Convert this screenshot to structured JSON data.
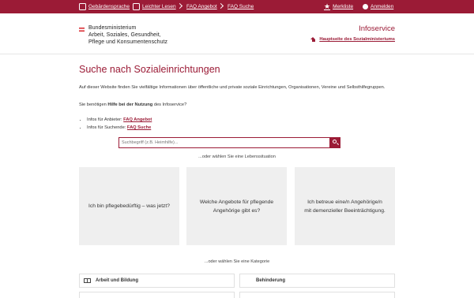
{
  "topbar": {
    "sign_language": "Gebärdensprache",
    "easy_reading": "Leichter Lesen",
    "faq_offer": "FAQ Angebot",
    "faq_search": "FAQ Suche",
    "watchlist": "Merkliste",
    "login": "Anmelden"
  },
  "header": {
    "ministry_line1": "Bundesministerium",
    "ministry_line2": "Arbeit, Soziales, Gesundheit,",
    "ministry_line3": "Pflege und Konsumentenschutz",
    "service_name": "Infoservice",
    "home_link": "Hauptseite des Sozialministeriums"
  },
  "main": {
    "title": "Suche nach Sozialeinrichtungen",
    "intro": "Auf dieser Website finden Sie vielfältige Informationen über öffentliche und private soziale Einrichtungen, Organisationen, Vereine und Selbsthilfegruppen.",
    "help_prefix": "Sie benötigen ",
    "help_bold": "Hilfe bei der Nutzung",
    "help_suffix": " des Infoservice?",
    "bullets": [
      {
        "prefix": "Infos für Anbieter: ",
        "link": "FAQ Angebot"
      },
      {
        "prefix": "Infos für Suchende: ",
        "link": "FAQ Suche"
      }
    ],
    "search_placeholder": "Suchbegriff (z.B. Heimhilfe)...",
    "situation_prompt": "...oder wählen Sie eine Lebenssituation",
    "situations": [
      "Ich bin pflegebedürftig – was jetzt?",
      "Welche Angebote für pflegende Angehörige gibt es?",
      "Ich betreue eine/n Angehörige/n mit demenzieller Beeinträchtigung."
    ],
    "category_prompt": "...oder wählen Sie eine Kategorie",
    "categories": [
      "Arbeit und Bildung",
      "Behinderung"
    ]
  },
  "colors": {
    "accent": "#9b1b36",
    "card_bg": "#efefef"
  }
}
